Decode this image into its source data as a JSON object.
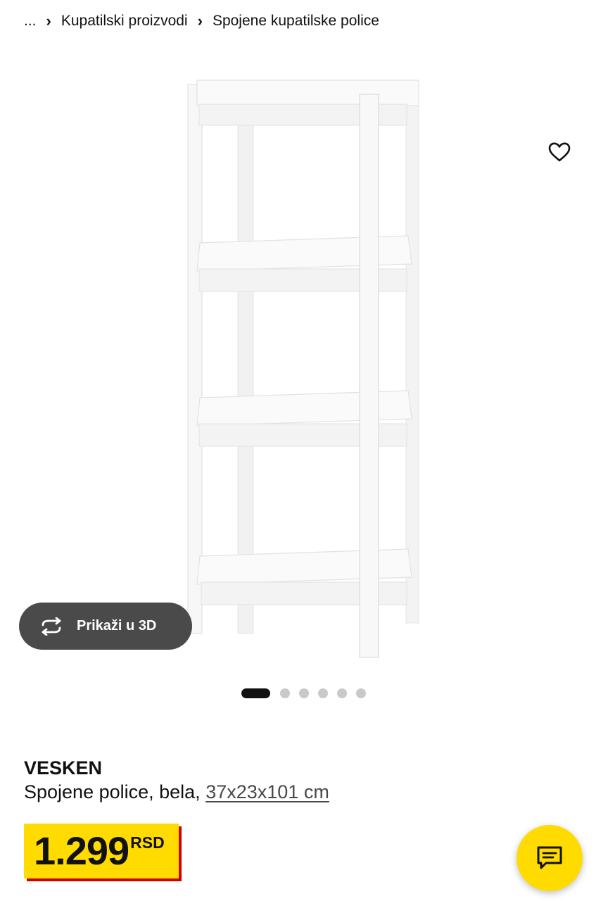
{
  "breadcrumb": {
    "items": [
      "...",
      "Kupatilski proizvodi",
      "Spojene kupatilske police"
    ],
    "separator": "›"
  },
  "gallery": {
    "image_alt": "VESKEN shelf unit",
    "view3d_label": "Prikaži u 3D",
    "view3d_icon": "rotate-3d-icon",
    "favorite_icon": "heart-outline-icon",
    "slides_total": 6,
    "active_slide": 1
  },
  "product": {
    "name": "VESKEN",
    "description": "Spojene police, bela,",
    "dimensions": "37x23x101 cm"
  },
  "price": {
    "value": "1.299",
    "currency": "RSD"
  },
  "chat": {
    "icon": "chat-bubble-icon"
  },
  "colors": {
    "brand_yellow": "#ffdb00",
    "price_shadow_red": "#cc0008",
    "button_dark": "#4a4a4a",
    "dot_active": "#111111",
    "dot_inactive": "#c9c9c9"
  }
}
